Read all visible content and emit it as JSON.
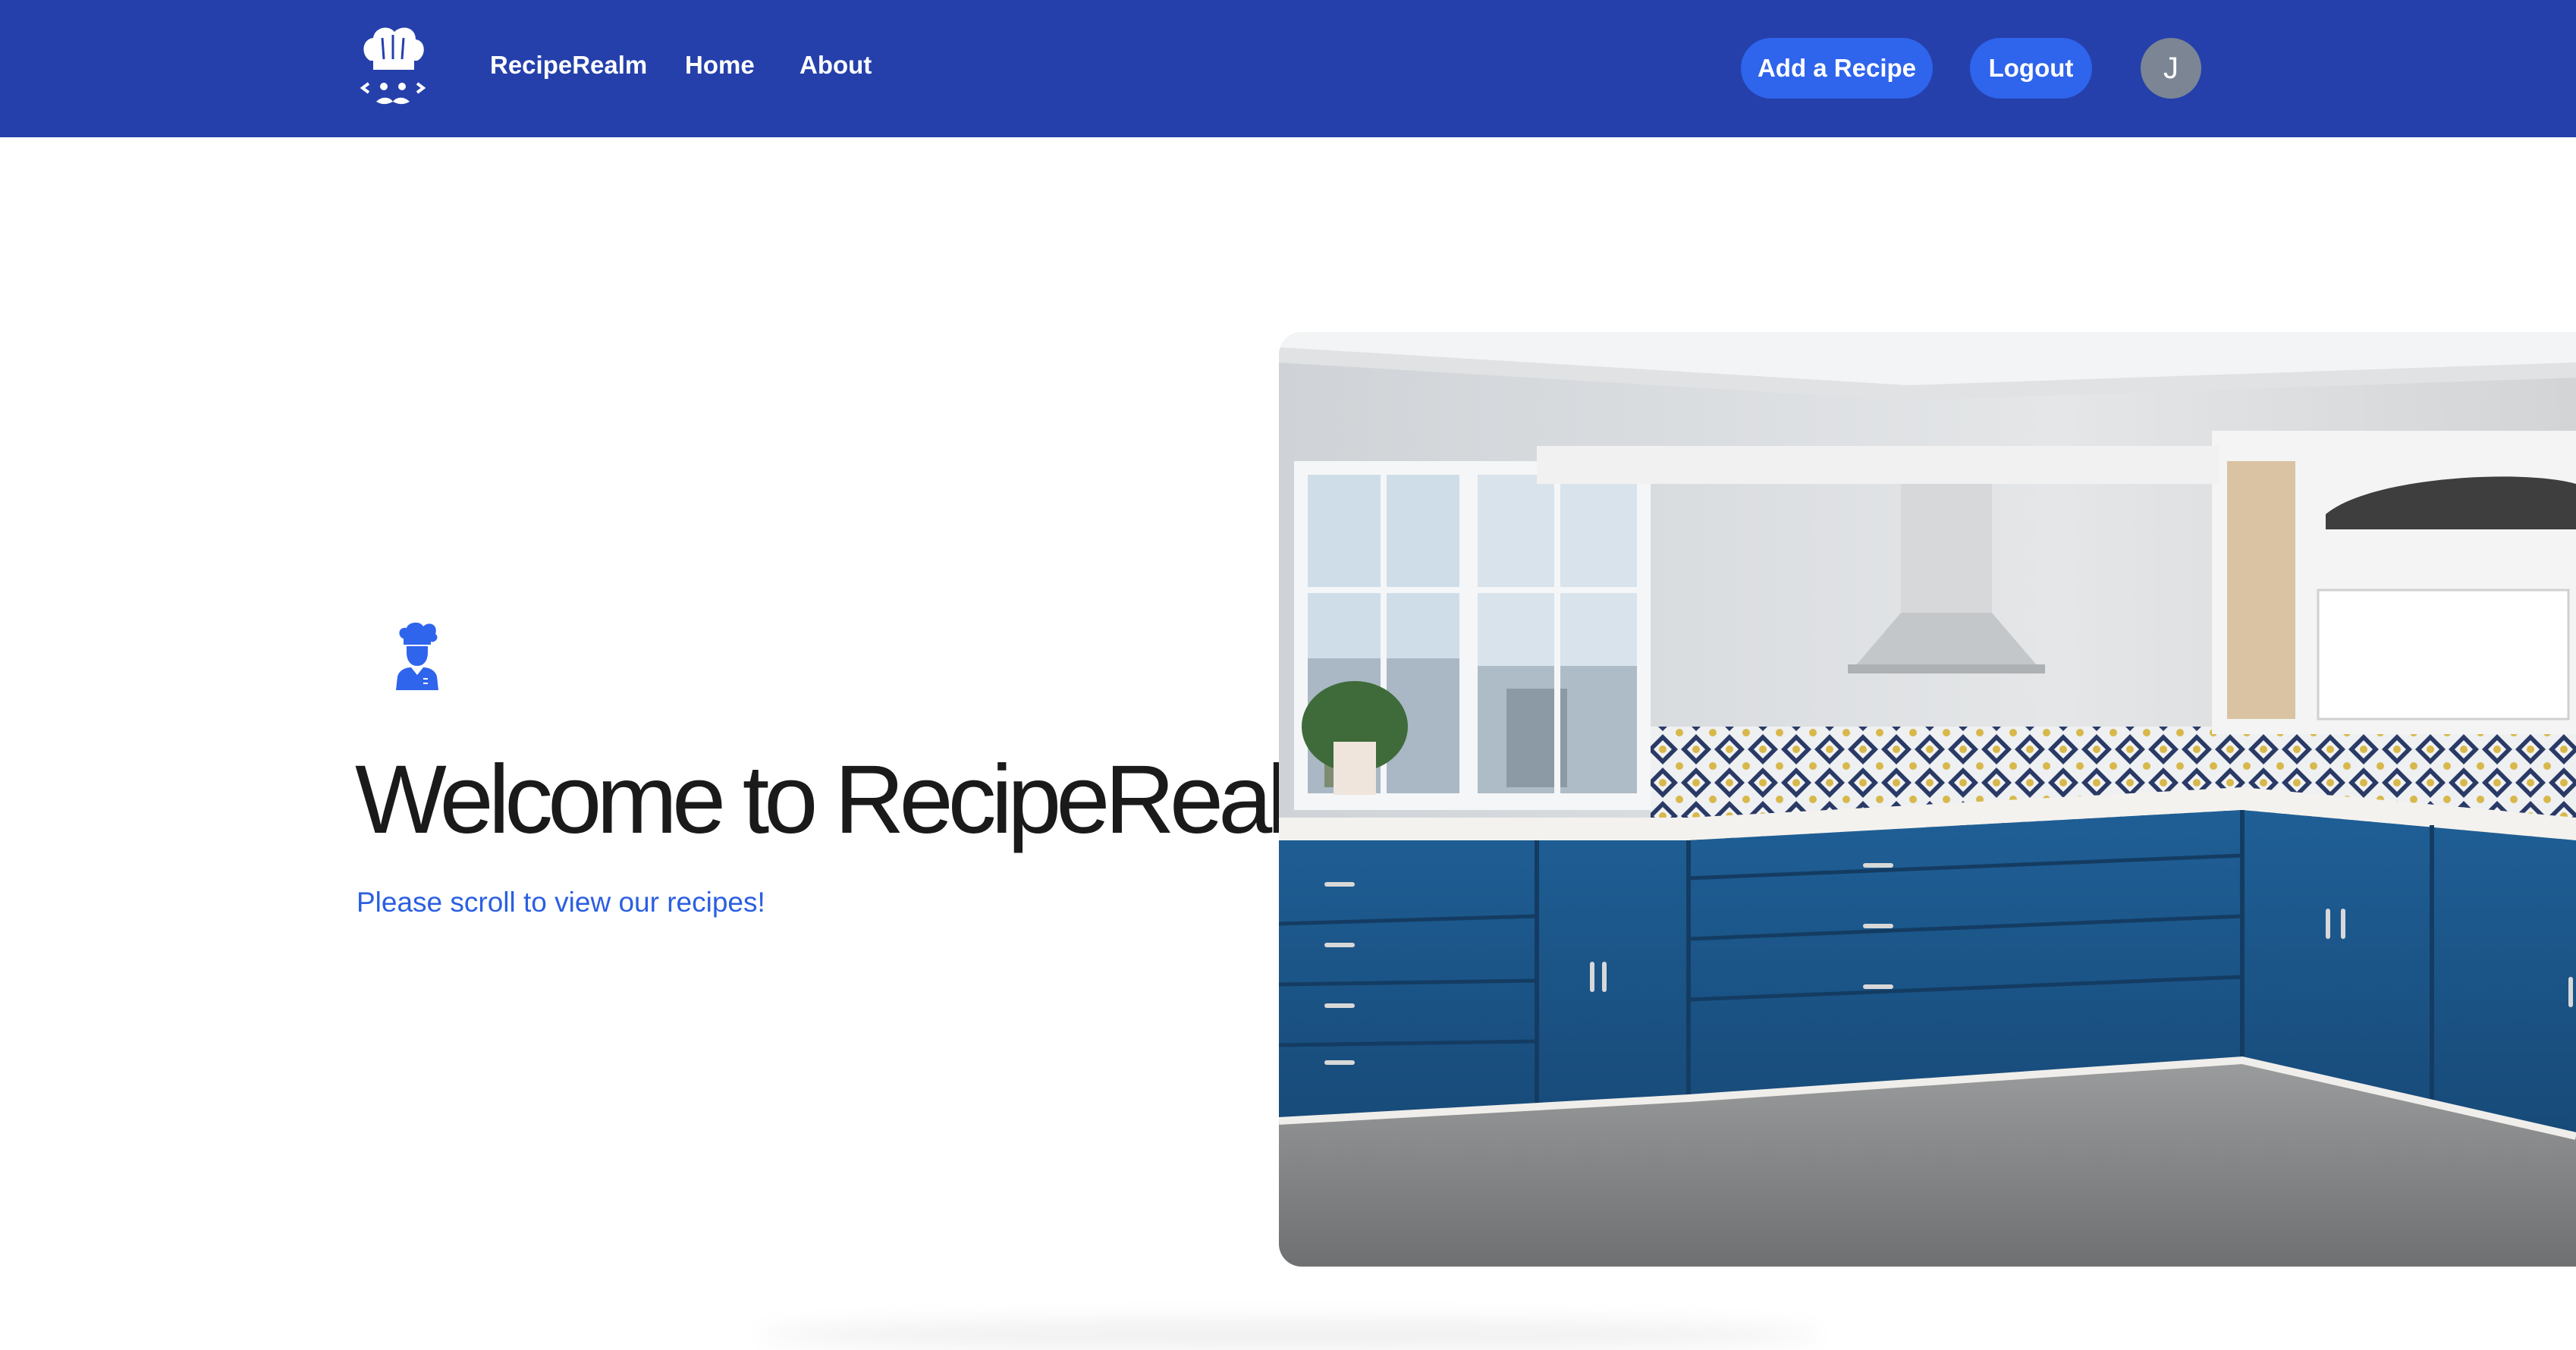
{
  "navbar": {
    "brand": "RecipeRealm",
    "links": [
      "Home",
      "About"
    ],
    "add_recipe_label": "Add a Recipe",
    "logout_label": "Logout",
    "avatar_initial": "J",
    "icons": {
      "logo": "chef-hat-logo-icon"
    }
  },
  "hero": {
    "title": "Welcome to RecipeRealm",
    "subtitle": "Please scroll to view our recipes!",
    "icons": {
      "chef": "chef-icon"
    },
    "image": "kitchen-photo"
  },
  "colors": {
    "navbar_bg": "#2540ab",
    "button_bg": "#2f64ec",
    "avatar_bg": "#7b8594",
    "accent_text": "#2b5fe0",
    "title_text": "#1a1a1a"
  }
}
